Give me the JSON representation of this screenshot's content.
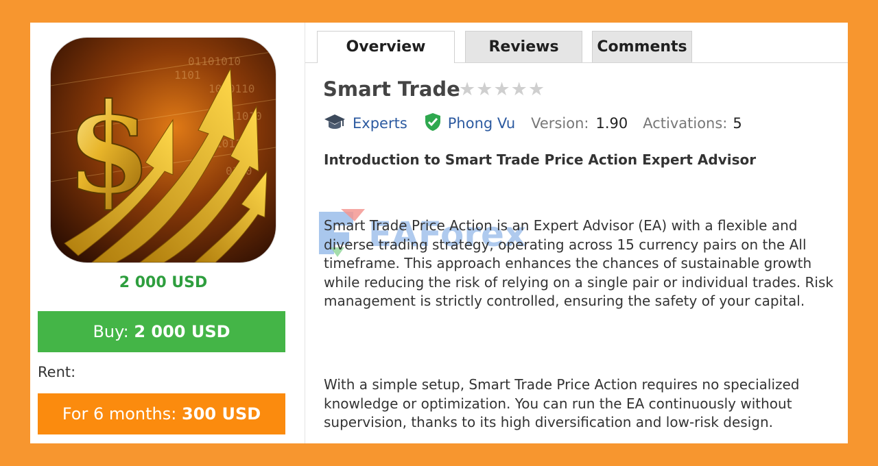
{
  "tabs": [
    {
      "label": "Overview",
      "active": true
    },
    {
      "label": "Reviews",
      "active": false
    },
    {
      "label": "Comments",
      "active": false
    }
  ],
  "product": {
    "title": "Smart Trade",
    "rating": {
      "value": 0,
      "max": 5
    },
    "category": "Experts",
    "author": "Phong Vu",
    "version_label": "Version:",
    "version": "1.90",
    "activations_label": "Activations:",
    "activations": "5"
  },
  "pricing": {
    "price": "2 000 USD",
    "buy_prefix": "Buy:",
    "buy_value": "2 000 USD",
    "rent_label": "Rent:",
    "rent_prefix": "For 6 months:",
    "rent_value": "300 USD"
  },
  "description": {
    "subtitle": "Introduction to Smart Trade Price Action Expert Advisor",
    "paragraph1": "Smart Trade Price Action is an Expert Advisor (EA) with a flexible and diverse trading strategy, operating across 15 currency pairs on the All timeframe. This approach enhances the chances of sustainable growth while reducing the risk of relying on a single pair or individual trades. Risk management is strictly controlled, ensuring the safety of your capital.",
    "paragraph2": "With a simple setup, Smart Trade Price Action requires no specialized knowledge or optimization. You can run the EA continuously without supervision, thanks to its high diversification and low-risk design."
  },
  "watermark": "EAForex",
  "icons": {
    "category": "graduation-cap-icon",
    "verified": "verified-shield-icon",
    "star": "star-icon"
  },
  "colors": {
    "background": "#f7962f",
    "buy": "#44b547",
    "rent": "#fb8b0e",
    "price": "#2e9e3e",
    "link": "#2c5aa0"
  }
}
